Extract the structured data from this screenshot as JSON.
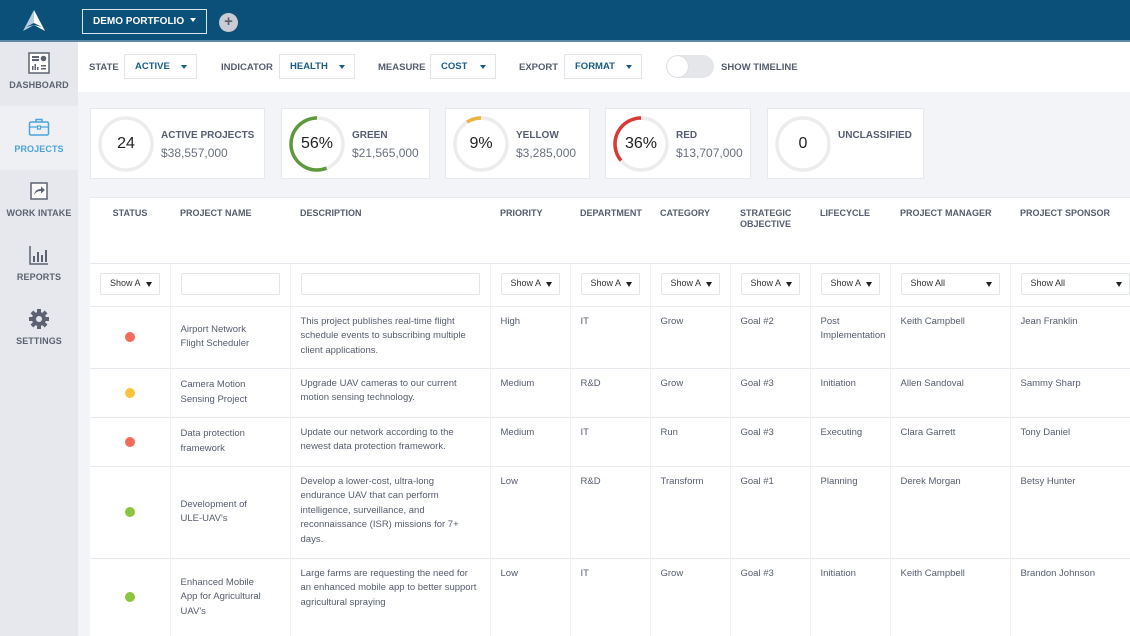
{
  "header": {
    "portfolio_label": "DEMO PORTFOLIO",
    "add_label": "+"
  },
  "sidebar": {
    "items": [
      {
        "label": "DASHBOARD",
        "icon": "dashboard-icon",
        "active": false
      },
      {
        "label": "PROJECTS",
        "icon": "briefcase-icon",
        "active": true
      },
      {
        "label": "WORK INTAKE",
        "icon": "share-icon",
        "active": false
      },
      {
        "label": "REPORTS",
        "icon": "bar-chart-icon",
        "active": false
      },
      {
        "label": "SETTINGS",
        "icon": "gear-icon",
        "active": false
      }
    ]
  },
  "filters": {
    "state_label": "STATE",
    "state_value": "ACTIVE",
    "indicator_label": "INDICATOR",
    "indicator_value": "HEALTH",
    "measure_label": "MEASURE",
    "measure_value": "COST",
    "export_label": "EXPORT",
    "export_value": "FORMAT",
    "timeline_label": "SHOW TIMELINE",
    "timeline_on": false
  },
  "summary": {
    "active": {
      "value": "24",
      "title": "ACTIVE PROJECTS",
      "amount": "$38,557,000"
    },
    "green": {
      "value": "56%",
      "percent": 56,
      "title": "GREEN",
      "amount": "$21,565,000",
      "color": "#5e9a3c"
    },
    "yellow": {
      "value": "9%",
      "percent": 9,
      "title": "YELLOW",
      "amount": "$3,285,000",
      "color": "#e9b43f"
    },
    "red": {
      "value": "36%",
      "percent": 36,
      "title": "RED",
      "amount": "$13,707,000",
      "color": "#d83a34"
    },
    "unclassified": {
      "value": "0",
      "title": "UNCLASSIFIED",
      "amount": ""
    }
  },
  "table": {
    "headers": [
      "STATUS",
      "PROJECT NAME",
      "DESCRIPTION",
      "PRIORITY",
      "DEPARTMENT",
      "CATEGORY",
      "STRATEGIC OBJECTIVE",
      "LIFECYCLE",
      "PROJECT MANAGER",
      "PROJECT SPONSOR"
    ],
    "filter_short": "Show A",
    "filter_full": "Show All",
    "status_colors": {
      "red": "#f26b5b",
      "yellow": "#fcc43c",
      "green": "#8cc63f"
    },
    "rows": [
      {
        "status": "red",
        "name": "Airport Network Flight Scheduler",
        "description": "This project publishes real-time flight schedule events to subscribing multiple client applications.",
        "priority": "High",
        "department": "IT",
        "category": "Grow",
        "objective": "Goal #2",
        "lifecycle": "Post Implementation",
        "manager": "Keith Campbell",
        "sponsor": "Jean Franklin"
      },
      {
        "status": "yellow",
        "name": "Camera Motion Sensing Project",
        "description": "Upgrade UAV cameras to our current motion sensing technology.",
        "priority": "Medium",
        "department": "R&D",
        "category": "Grow",
        "objective": "Goal #3",
        "lifecycle": "Initiation",
        "manager": "Allen Sandoval",
        "sponsor": "Sammy Sharp"
      },
      {
        "status": "red",
        "name": "Data protection framework",
        "description": "Update our network according to the newest data protection framework.",
        "priority": "Medium",
        "department": "IT",
        "category": "Run",
        "objective": "Goal #3",
        "lifecycle": "Executing",
        "manager": "Clara Garrett",
        "sponsor": "Tony Daniel"
      },
      {
        "status": "green",
        "name": "Development of ULE-UAV's",
        "description": "Develop a lower-cost, ultra-long endurance UAV that can perform intelligence, surveillance, and reconnaissance (ISR) missions for 7+ days.",
        "priority": "Low",
        "department": "R&D",
        "category": "Transform",
        "objective": "Goal #1",
        "lifecycle": "Planning",
        "manager": "Derek Morgan",
        "sponsor": "Betsy Hunter"
      },
      {
        "status": "green",
        "name": "Enhanced Mobile App for Agricultural UAV's",
        "description": "Large farms are requesting the need for an enhanced mobile app to better support agricultural spraying",
        "priority": "Low",
        "department": "IT",
        "category": "Grow",
        "objective": "Goal #3",
        "lifecycle": "Initiation",
        "manager": "Keith Campbell",
        "sponsor": "Brandon Johnson"
      }
    ]
  }
}
